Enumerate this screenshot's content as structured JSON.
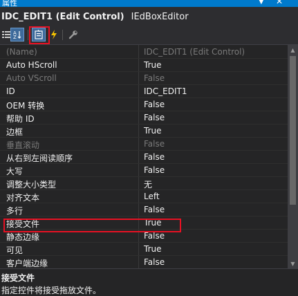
{
  "window": {
    "title": "属性"
  },
  "object": {
    "name": "IDC_EDIT1 (Edit Control)",
    "type": "IEdBoxEditor"
  },
  "properties": [
    {
      "name": "(Name)",
      "value": "IDC_EDIT1 (Edit Control)",
      "dim": true
    },
    {
      "name": "Auto HScroll",
      "value": "True",
      "dim": false
    },
    {
      "name": "Auto VScroll",
      "value": "False",
      "dim": true
    },
    {
      "name": "ID",
      "value": "IDC_EDIT1",
      "dim": false
    },
    {
      "name": "OEM 转换",
      "value": "False",
      "dim": false
    },
    {
      "name": "帮助 ID",
      "value": "False",
      "dim": false
    },
    {
      "name": "边框",
      "value": "True",
      "dim": false
    },
    {
      "name": "垂直滚动",
      "value": "False",
      "dim": true
    },
    {
      "name": "从右到左阅读顺序",
      "value": "False",
      "dim": false
    },
    {
      "name": "大写",
      "value": "False",
      "dim": false
    },
    {
      "name": "调整大小类型",
      "value": "无",
      "dim": false
    },
    {
      "name": "对齐文本",
      "value": "Left",
      "dim": false
    },
    {
      "name": "多行",
      "value": "False",
      "dim": false
    },
    {
      "name": "接受文件",
      "value": "True",
      "dim": false
    },
    {
      "name": "静态边缘",
      "value": "False",
      "dim": false
    },
    {
      "name": "可见",
      "value": "True",
      "dim": false
    },
    {
      "name": "客户端边缘",
      "value": "False",
      "dim": false
    }
  ],
  "description": {
    "title": "接受文件",
    "text": "指定控件将接受拖放文件。"
  }
}
